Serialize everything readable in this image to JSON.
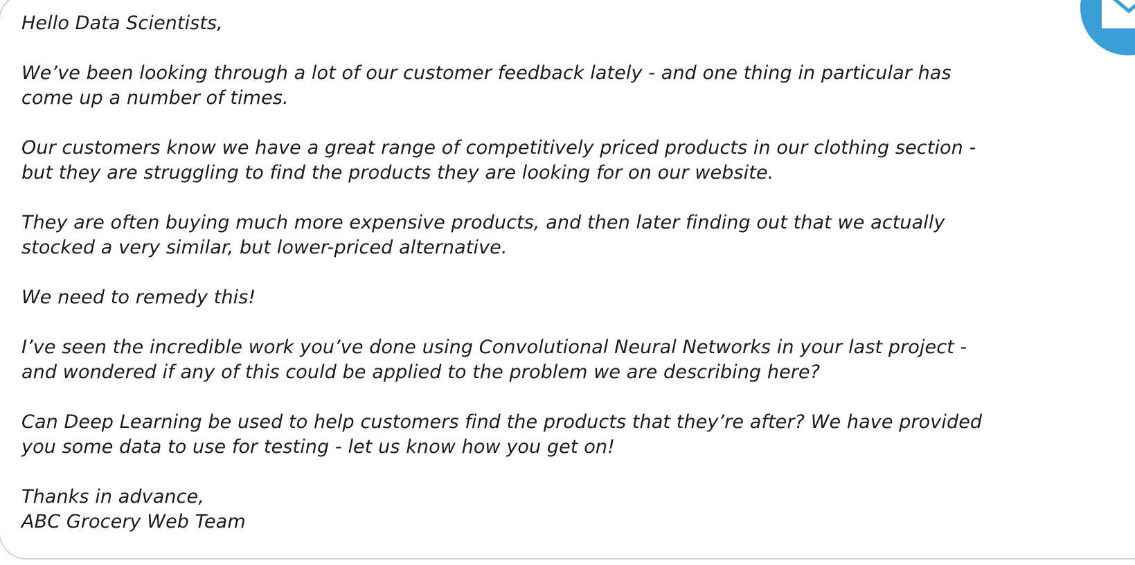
{
  "email": {
    "greeting": "Hello Data Scientists,",
    "paragraphs": [
      [
        "We’ve been looking through a lot of our customer feedback lately - and one thing in particular has",
        "come up a number of times."
      ],
      [
        "Our customers know we have a great range of competitively priced products in our clothing section -",
        "but they are struggling to find the products they are looking for on our website."
      ],
      [
        "They are often buying much more expensive products, and then later finding out that we actually",
        "stocked a very similar, but lower-priced alternative."
      ],
      [
        "We need to remedy this!"
      ],
      [
        "I’ve seen the incredible work you’ve done using Convolutional Neural Networks in your last project -",
        "and wondered if any of this could be applied to the problem we are describing here?"
      ],
      [
        "Can Deep Learning be used to help customers find the products that they’re after?  We have provided",
        "you some data to use for testing - let us know how you get on!"
      ]
    ],
    "signoff": "Thanks in advance,",
    "signature": "ABC Grocery Web Team"
  },
  "icons": {
    "mail_icon": "envelope-icon",
    "badge_color": "#3a9fd6"
  }
}
